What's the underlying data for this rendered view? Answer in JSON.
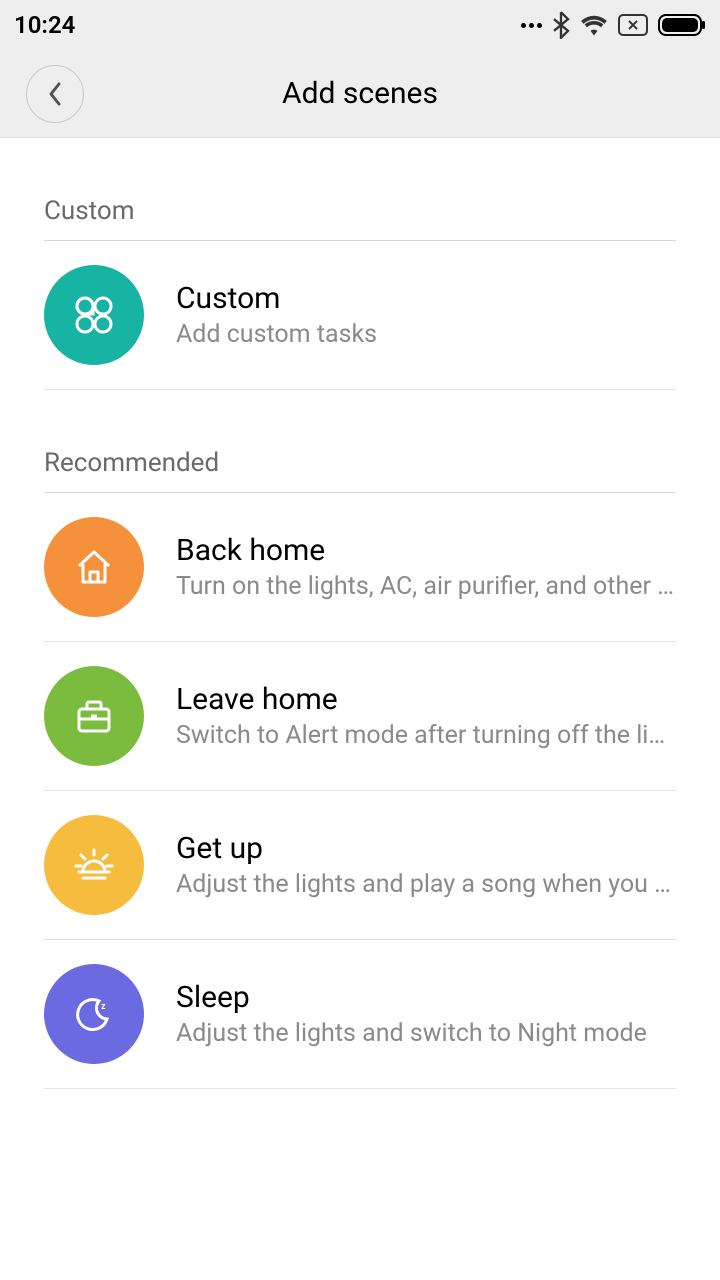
{
  "status": {
    "time": "10:24"
  },
  "header": {
    "title": "Add scenes"
  },
  "sections": {
    "custom": {
      "header": "Custom",
      "item": {
        "title": "Custom",
        "subtitle": "Add custom tasks"
      }
    },
    "recommended": {
      "header": "Recommended",
      "items": [
        {
          "title": "Back home",
          "subtitle": "Turn on the lights, AC, air purifier, and other devices"
        },
        {
          "title": "Leave home",
          "subtitle": "Switch to Alert mode after turning off the lights"
        },
        {
          "title": "Get up",
          "subtitle": "Adjust the lights and play a song when you get up"
        },
        {
          "title": "Sleep",
          "subtitle": "Adjust the lights and switch to Night mode"
        }
      ]
    }
  }
}
